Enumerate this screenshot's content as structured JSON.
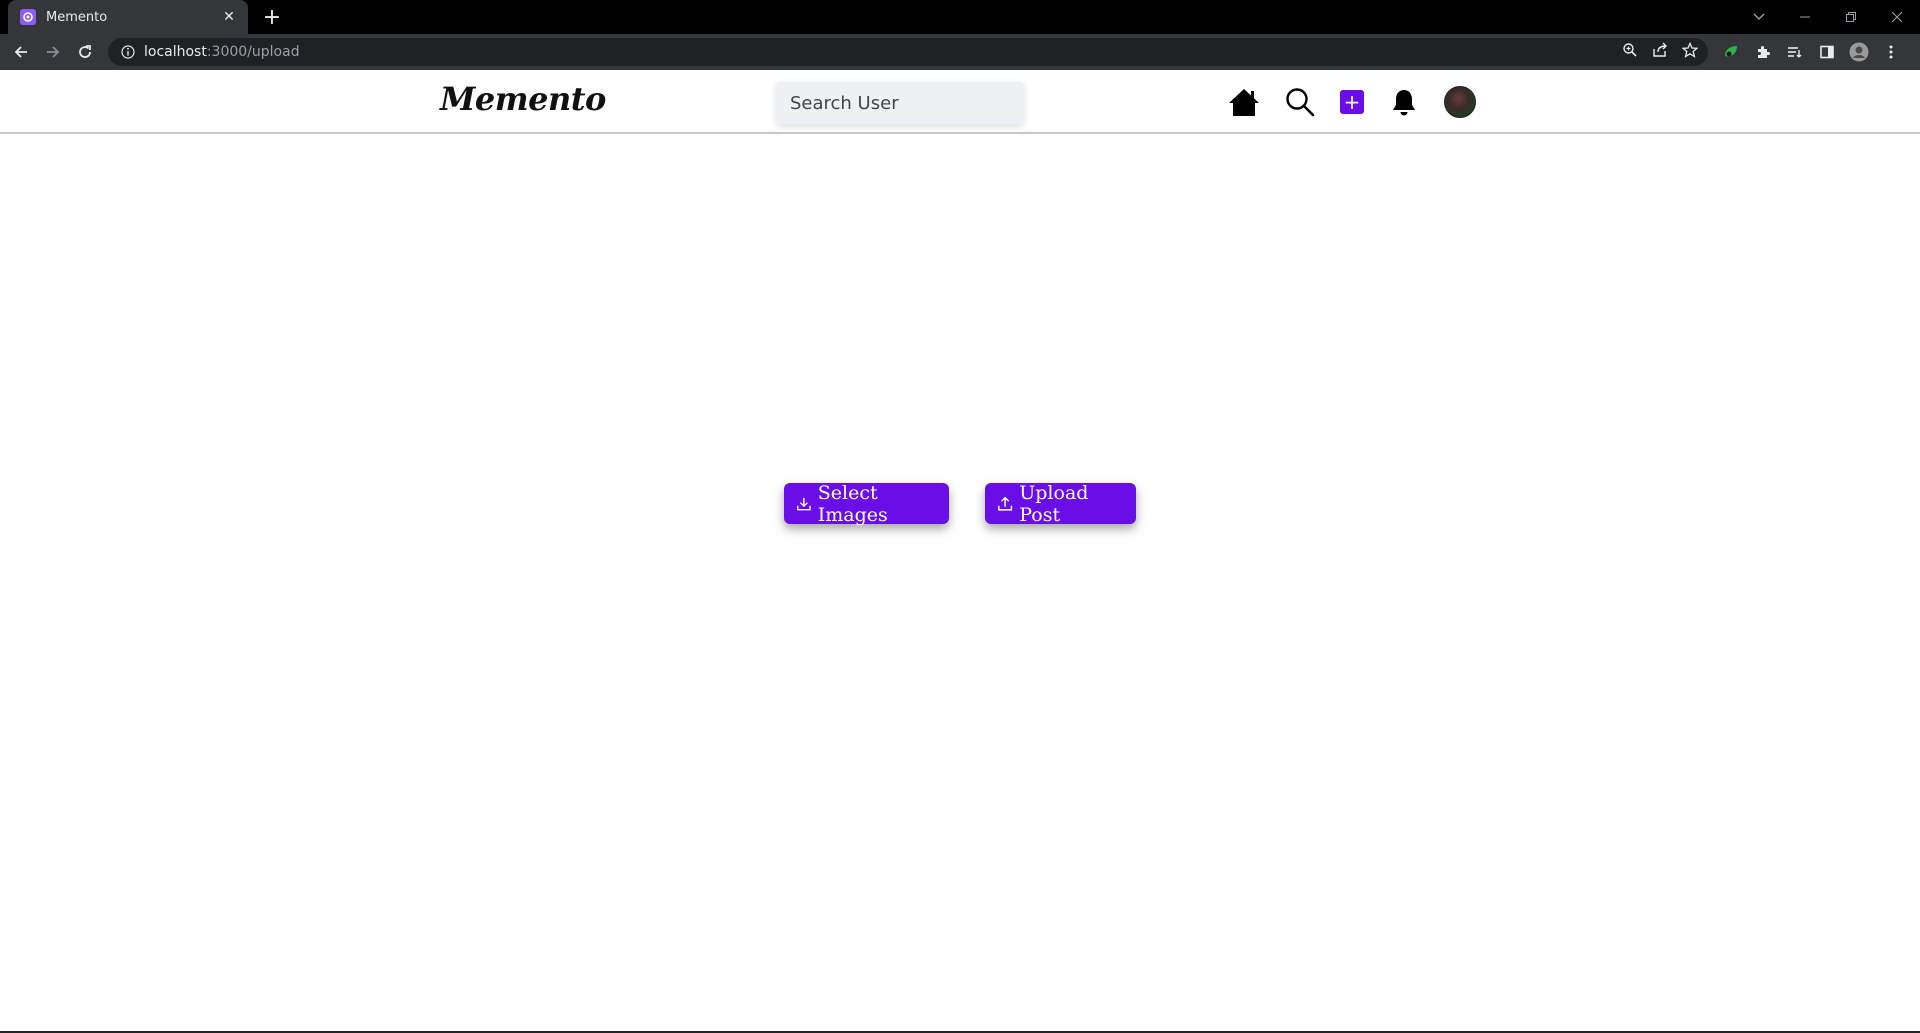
{
  "browser": {
    "tab": {
      "title": "Memento",
      "favicon": "memento-favicon"
    },
    "url": {
      "host": "localhost",
      "path": ":3000/upload"
    },
    "colors": {
      "tabstrip": "#000000",
      "toolbar": "#35363a",
      "omnibox": "#202124"
    }
  },
  "header": {
    "logo": "Memento",
    "search": {
      "placeholder": "Search User",
      "value": ""
    },
    "icons": [
      "home-icon",
      "search-icon",
      "add-post-icon",
      "bell-icon",
      "avatar"
    ]
  },
  "main": {
    "select_label": "Select Images",
    "upload_label": "Upload Post"
  },
  "theme": {
    "accent": "#6a0ee8"
  }
}
